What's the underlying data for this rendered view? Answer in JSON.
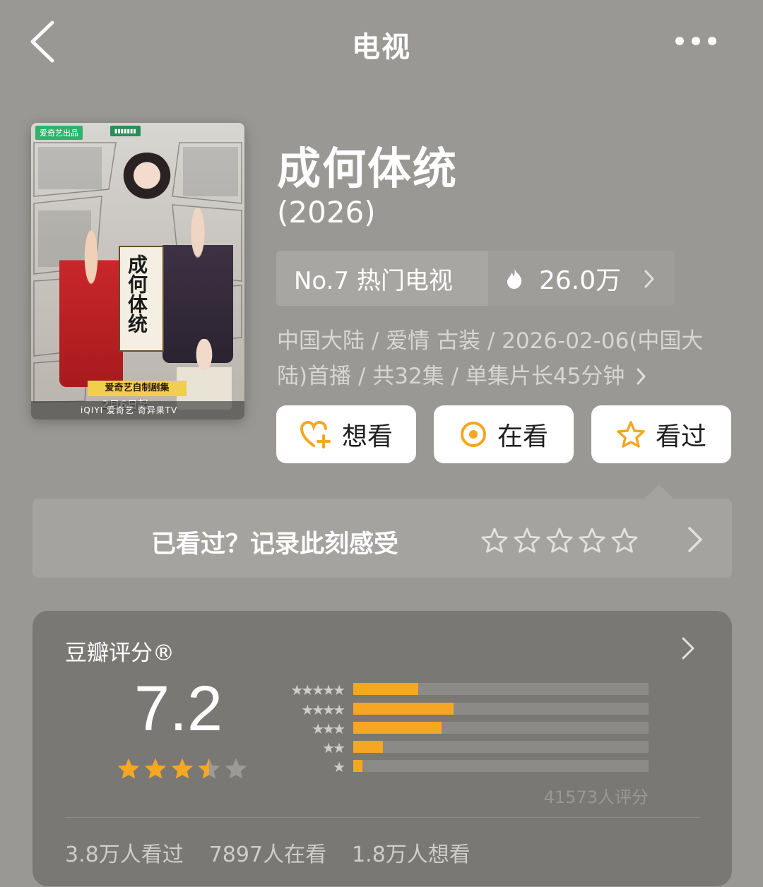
{
  "header": {
    "title": "电视"
  },
  "poster": {
    "tag_left": "爱奇艺出品",
    "scroll_text": "成何体统",
    "banner": "爱奇艺自制剧集",
    "date": "2月6日起",
    "bottom_text": "iQIYI 爱奇艺   奇异果TV"
  },
  "show": {
    "title": "成何体统",
    "year": "(2026)",
    "rank_label": "No.7 热门电视",
    "heat_value": "26.0万",
    "meta_line1": "中国大陆 / 爱情 古装 / 2026-02-06(中国大",
    "meta_line2": "陆)首播 / 共32集 / 单集片长45分钟"
  },
  "actions": {
    "want": "想看",
    "watching": "在看",
    "watched": "看过"
  },
  "rate_prompt": {
    "text": "已看过？记录此刻感受"
  },
  "douban": {
    "title": "豆瓣评分®",
    "score": "7.2",
    "star_rating": 3.5,
    "distribution": [
      {
        "stars": 5,
        "percent": 22
      },
      {
        "stars": 4,
        "percent": 34
      },
      {
        "stars": 3,
        "percent": 30
      },
      {
        "stars": 2,
        "percent": 10
      },
      {
        "stars": 1,
        "percent": 3
      }
    ],
    "rating_count": "41573人评分",
    "stats": {
      "watched": "3.8万人看过",
      "watching": "7897人在看",
      "want": "1.8万人想看"
    }
  },
  "colors": {
    "background": "#9a9894",
    "accent": "#f5a623",
    "card": "#7a7875"
  }
}
